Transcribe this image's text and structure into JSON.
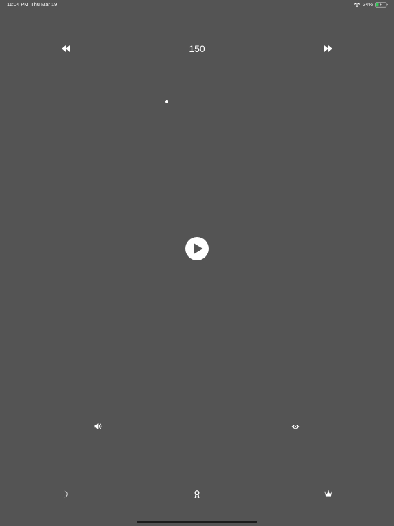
{
  "status_bar": {
    "time": "11:04 PM",
    "date": "Thu Mar 19",
    "battery_percent": "24%",
    "battery_level": 0.24,
    "battery_color": "#34c759"
  },
  "metronome": {
    "tempo": "150",
    "is_playing": false,
    "beat_indicator_active": true
  },
  "controls": {
    "rewind_icon": "rewind-icon",
    "forward_icon": "fast-forward-icon",
    "play_icon": "play-icon",
    "sound_icon": "speaker-icon",
    "visual_icon": "eye-icon",
    "night_icon": "moon-icon",
    "award_icon": "award-ribbon-icon",
    "premium_icon": "crown-icon"
  },
  "colors": {
    "background": "#545454",
    "foreground": "#ffffff",
    "play_triangle": "#545454",
    "home_indicator": "#1c1c1c"
  }
}
